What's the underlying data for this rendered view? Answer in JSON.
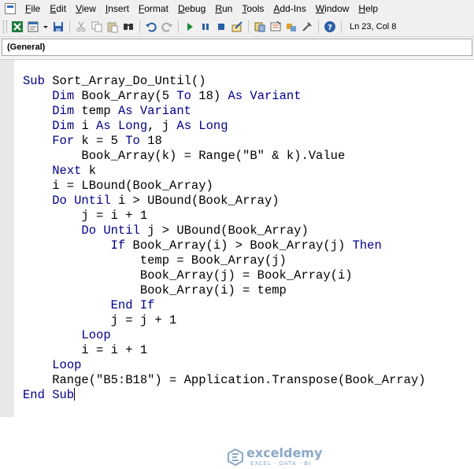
{
  "menu": [
    "File",
    "Edit",
    "View",
    "Insert",
    "Format",
    "Debug",
    "Run",
    "Tools",
    "Add-Ins",
    "Window",
    "Help"
  ],
  "toolbar": {
    "position": "Ln 23, Col 8",
    "icons": [
      "view-excel-icon",
      "insert-module-icon",
      "dropdown-icon",
      "save-icon",
      "cut-icon",
      "copy-icon",
      "paste-icon",
      "find-icon",
      "undo-icon",
      "redo-icon",
      "run-icon",
      "break-icon",
      "reset-icon",
      "design-mode-icon",
      "project-explorer-icon",
      "properties-icon",
      "object-browser-icon",
      "toolbox-icon",
      "help-icon"
    ]
  },
  "procedure_combo": {
    "value": "(General)"
  },
  "code": {
    "lines": [
      [
        {
          "t": "Sub ",
          "k": 1
        },
        {
          "t": "Sort_Array_Do_Until()"
        }
      ],
      [
        {
          "t": "    "
        },
        {
          "t": "Dim ",
          "k": 1
        },
        {
          "t": "Book_Array(5 "
        },
        {
          "t": "To ",
          "k": 1
        },
        {
          "t": "18) "
        },
        {
          "t": "As Variant",
          "k": 1
        }
      ],
      [
        {
          "t": "    "
        },
        {
          "t": "Dim ",
          "k": 1
        },
        {
          "t": "temp "
        },
        {
          "t": "As Variant",
          "k": 1
        }
      ],
      [
        {
          "t": "    "
        },
        {
          "t": "Dim ",
          "k": 1
        },
        {
          "t": "i "
        },
        {
          "t": "As Long",
          "k": 1
        },
        {
          "t": ", j "
        },
        {
          "t": "As Long",
          "k": 1
        }
      ],
      [
        {
          "t": "    "
        },
        {
          "t": "For ",
          "k": 1
        },
        {
          "t": "k = 5 "
        },
        {
          "t": "To ",
          "k": 1
        },
        {
          "t": "18"
        }
      ],
      [
        {
          "t": "        Book_Array(k) = Range(\"B\" & k).Value"
        }
      ],
      [
        {
          "t": "    "
        },
        {
          "t": "Next ",
          "k": 1
        },
        {
          "t": "k"
        }
      ],
      [
        {
          "t": "    i = LBound(Book_Array)"
        }
      ],
      [
        {
          "t": "    "
        },
        {
          "t": "Do Until ",
          "k": 1
        },
        {
          "t": "i > UBound(Book_Array)"
        }
      ],
      [
        {
          "t": "        j = i + 1"
        }
      ],
      [
        {
          "t": "        "
        },
        {
          "t": "Do Until ",
          "k": 1
        },
        {
          "t": "j > UBound(Book_Array)"
        }
      ],
      [
        {
          "t": "            "
        },
        {
          "t": "If ",
          "k": 1
        },
        {
          "t": "Book_Array(i) > Book_Array(j) "
        },
        {
          "t": "Then",
          "k": 1
        }
      ],
      [
        {
          "t": "                temp = Book_Array(j)"
        }
      ],
      [
        {
          "t": "                Book_Array(j) = Book_Array(i)"
        }
      ],
      [
        {
          "t": "                Book_Array(i) = temp"
        }
      ],
      [
        {
          "t": "            "
        },
        {
          "t": "End If",
          "k": 1
        }
      ],
      [
        {
          "t": "            j = j + 1"
        }
      ],
      [
        {
          "t": "        "
        },
        {
          "t": "Loop",
          "k": 1
        }
      ],
      [
        {
          "t": "        i = i + 1"
        }
      ],
      [
        {
          "t": "    "
        },
        {
          "t": "Loop",
          "k": 1
        }
      ],
      [
        {
          "t": "    Range(\"B5:B18\") = Application.Transpose(Book_Array)"
        }
      ],
      [
        {
          "t": "End Sub",
          "k": 1
        }
      ]
    ]
  },
  "watermark": {
    "name": "exceldemy",
    "tagline": "EXCEL · DATA · BI"
  },
  "colors": {
    "keyword": "#00008b",
    "text": "#000000",
    "watermark": "#8aa8c8"
  }
}
